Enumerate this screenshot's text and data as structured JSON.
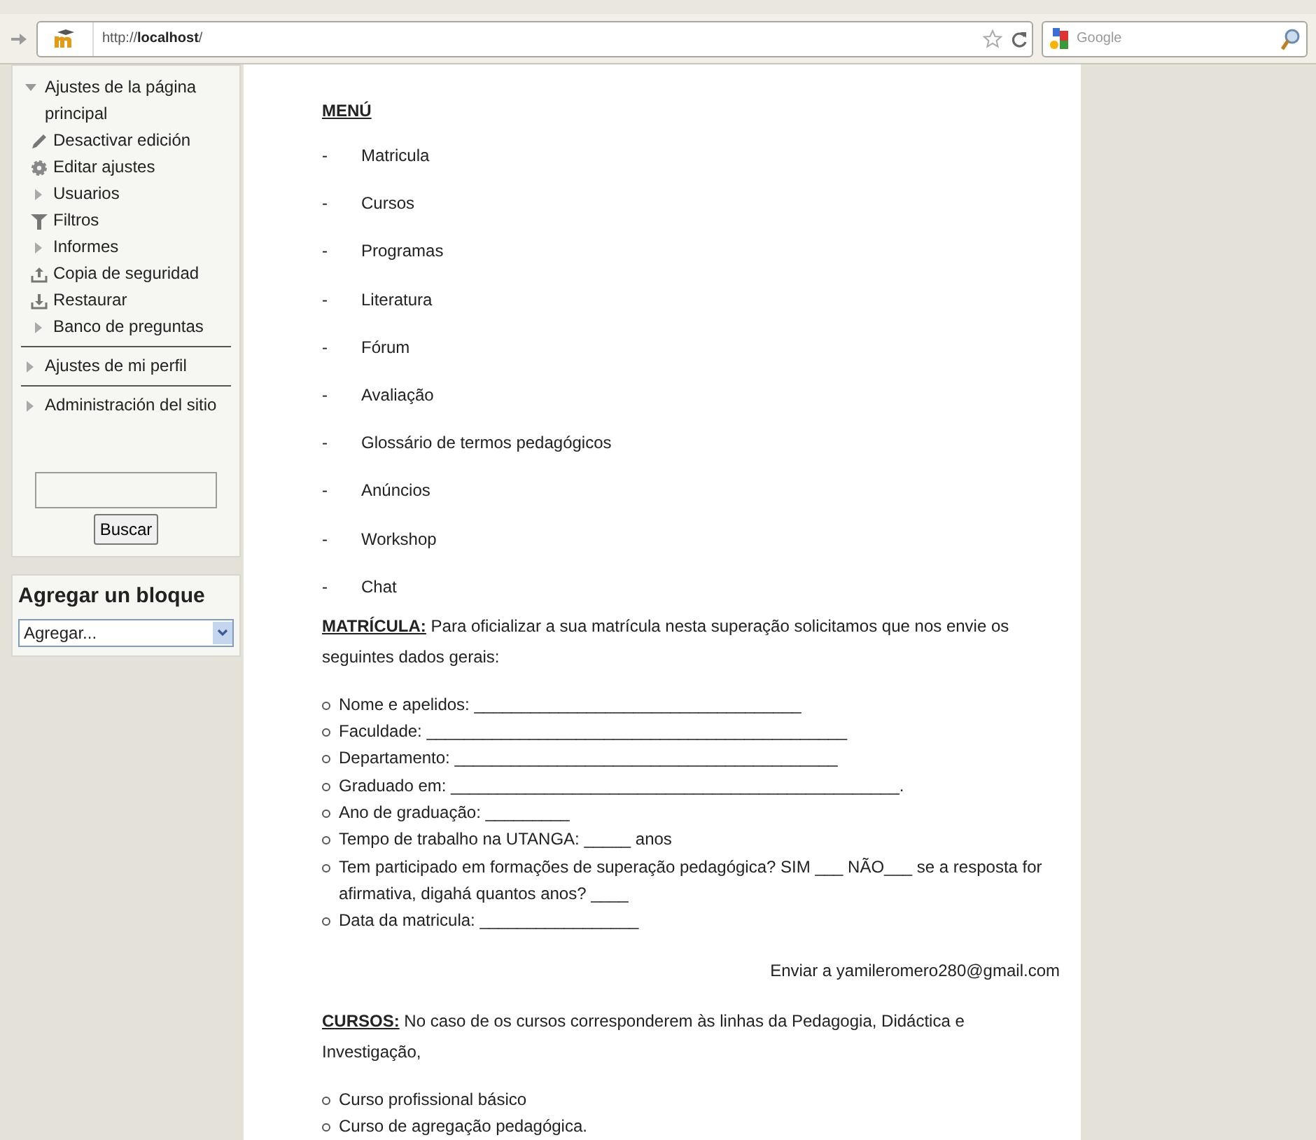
{
  "browser": {
    "url_prefix": "http://",
    "url_host": "localhost",
    "url_suffix": "/",
    "search_placeholder": "Google"
  },
  "sidebar": {
    "settings": [
      {
        "label": "Ajustes de la página principal",
        "kind": "expander",
        "expanded": true,
        "children": [
          {
            "label": "Desactivar edición",
            "kind": "pencil"
          },
          {
            "label": "Editar ajustes",
            "kind": "gear"
          },
          {
            "label": "Usuarios",
            "kind": "expander",
            "expanded": false
          },
          {
            "label": "Filtros",
            "kind": "filter"
          },
          {
            "label": "Informes",
            "kind": "expander",
            "expanded": false
          },
          {
            "label": "Copia de seguridad",
            "kind": "upload"
          },
          {
            "label": "Restaurar",
            "kind": "download"
          },
          {
            "label": "Banco de preguntas",
            "kind": "expander",
            "expanded": false
          }
        ]
      },
      {
        "label": "Ajustes de mi perfil",
        "kind": "expander",
        "expanded": false
      },
      {
        "label": "Administración del sitio",
        "kind": "expander",
        "expanded": false
      }
    ],
    "search_button": "Buscar",
    "add_block": {
      "title": "Agregar un bloque",
      "select": "Agregar..."
    }
  },
  "content": {
    "menu_title": "MENÚ",
    "bullet": "-",
    "menu_items": [
      "Matricula",
      "Cursos",
      "Programas",
      "Literatura",
      "Fórum",
      "Avaliação",
      "Glossário de termos pedagógicos",
      "Anúncios",
      "Workshop",
      "Chat"
    ],
    "matricula": {
      "lead": "MATRÍCULA:",
      "text": "Para oficializar a sua matrícula nesta superação solicitamos que nos envie os seguintes dados gerais:",
      "items": [
        "Nome e apelidos: ___________________________________",
        "Faculdade: _____________________________________________",
        "Departamento: _________________________________________",
        "Graduado em: ________________________________________________.",
        "Ano de graduação: _________",
        "Tempo de trabalho na UTANGA: _____ anos",
        "Tem participado em formações de superação pedagógica? SIM ___ NÃO___ se a resposta for afirmativa, digahá quantos anos? ____",
        "Data da matricula: _________________"
      ]
    },
    "send": "Enviar a yamileromero280@gmail.com",
    "cursos": {
      "lead": "CURSOS:",
      "text": "No caso de os cursos corresponderem às linhas da Pedagogia, Didáctica e Investigação,",
      "items": [
        "Curso profissional básico",
        "Curso de agregação pedagógica."
      ]
    }
  }
}
